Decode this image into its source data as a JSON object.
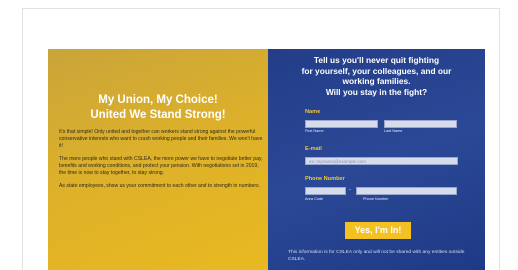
{
  "left": {
    "title_line1": "My Union, My Choice!",
    "title_line2": "United We Stand Strong!",
    "paragraphs": [
      "It's that simple! Only united and together can workers stand strong against the powerful conservative interests who want to crush working people and their families. We won't have it!",
      "The more people who stand with CSLEA, the more power we have to negotiate better pay, benefits and working conditions, and protect your pension. With negotiations set in 2019, the time is now to stay together, to stay strong.",
      "As state employees, show us your commitment to each other and to strength in numbers."
    ]
  },
  "form": {
    "title_lines": [
      "Tell us you'll never quit fighting",
      "for yourself, your colleagues, and our",
      "working families.",
      "Will you stay in the fight?"
    ],
    "name_label": "Name",
    "first_name_caption": "First Name",
    "last_name_caption": "Last Name",
    "email_label": "E-mail",
    "email_placeholder": "ex: myname@example.com",
    "phone_label": "Phone Number",
    "area_code_caption": "Area Code",
    "phone_caption": "Phone Number",
    "dash": "-",
    "submit_label": "Yes, I'm In!",
    "disclaimer": "This information is for CSLEA only and will not be shared with any entities outside CSLEA."
  }
}
